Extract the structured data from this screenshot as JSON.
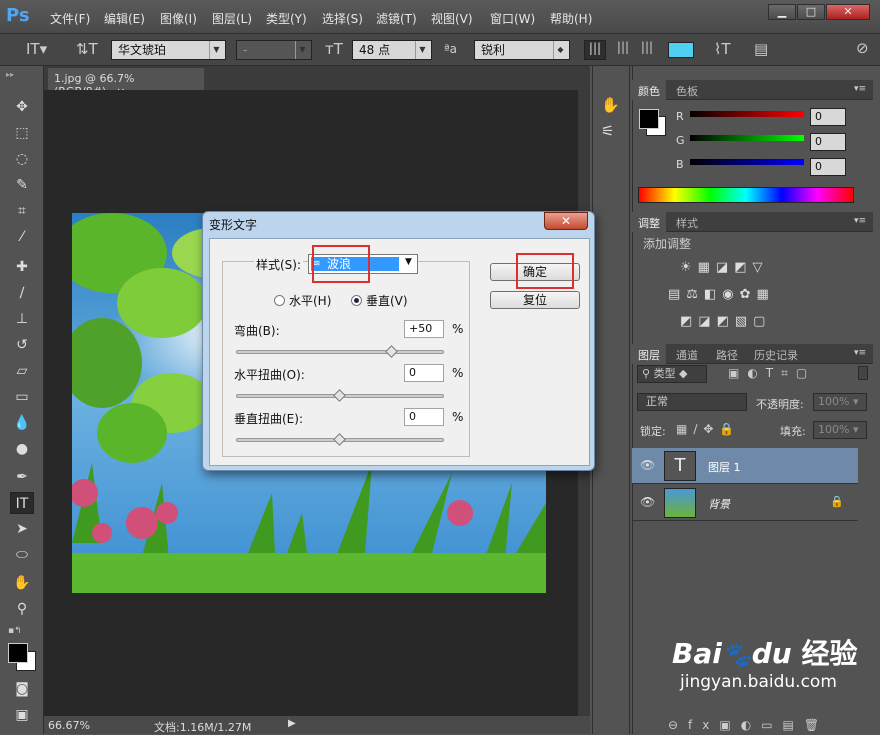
{
  "app": {
    "logo": "Ps"
  },
  "menu": [
    "文件(F)",
    "编辑(E)",
    "图像(I)",
    "图层(L)",
    "类型(Y)",
    "选择(S)",
    "滤镜(T)",
    "视图(V)",
    "窗口(W)",
    "帮助(H)"
  ],
  "window_controls": {
    "minimize": "▁",
    "maximize": "□",
    "close": "✕"
  },
  "options": {
    "font_family": "华文琥珀",
    "font_style": "-",
    "font_size": "48 点",
    "antialias_icon": "ªa",
    "antialias": "锐利",
    "text_color": "#4fd0f0"
  },
  "document": {
    "tab_title": "1.jpg @ 66.7%(RGB/8#)",
    "tab_close": "×",
    "zoom": "66.67%",
    "doc_size": "文档:1.16M/1.27M"
  },
  "color_panel": {
    "tabs": [
      "颜色",
      "色板"
    ],
    "r_label": "R",
    "g_label": "G",
    "b_label": "B",
    "r": "0",
    "g": "0",
    "b": "0"
  },
  "adjust_panel": {
    "tabs": [
      "调整",
      "样式"
    ],
    "title": "添加调整"
  },
  "layers_panel": {
    "tabs": [
      "图层",
      "通道",
      "路径",
      "历史记录"
    ],
    "filter_kind": "类型",
    "blend_mode": "正常",
    "opacity_label": "不透明度:",
    "opacity": "100%",
    "lock_label": "锁定:",
    "fill_label": "填充:",
    "fill": "100%",
    "layers": [
      {
        "name": "图层 1",
        "thumb": "T"
      },
      {
        "name": "背景"
      }
    ]
  },
  "dialog": {
    "title": "变形文字",
    "close": "✕",
    "style_label": "样式(S):",
    "style_value": "波浪",
    "horizontal": "水平(H)",
    "vertical": "垂直(V)",
    "orientation_selected": "vertical",
    "bend_label": "弯曲(B):",
    "bend_value": "+50",
    "hdist_label": "水平扭曲(O):",
    "hdist_value": "0",
    "vdist_label": "垂直扭曲(E):",
    "vdist_value": "0",
    "percent": "%",
    "ok": "确定",
    "reset": "复位",
    "bend_fraction": 0.75,
    "hdist_fraction": 0.5,
    "vdist_fraction": 0.5
  },
  "watermark": {
    "brand": "Bai",
    "brand2": "du",
    "cn": "经验",
    "url": "jingyan.baidu.com"
  }
}
